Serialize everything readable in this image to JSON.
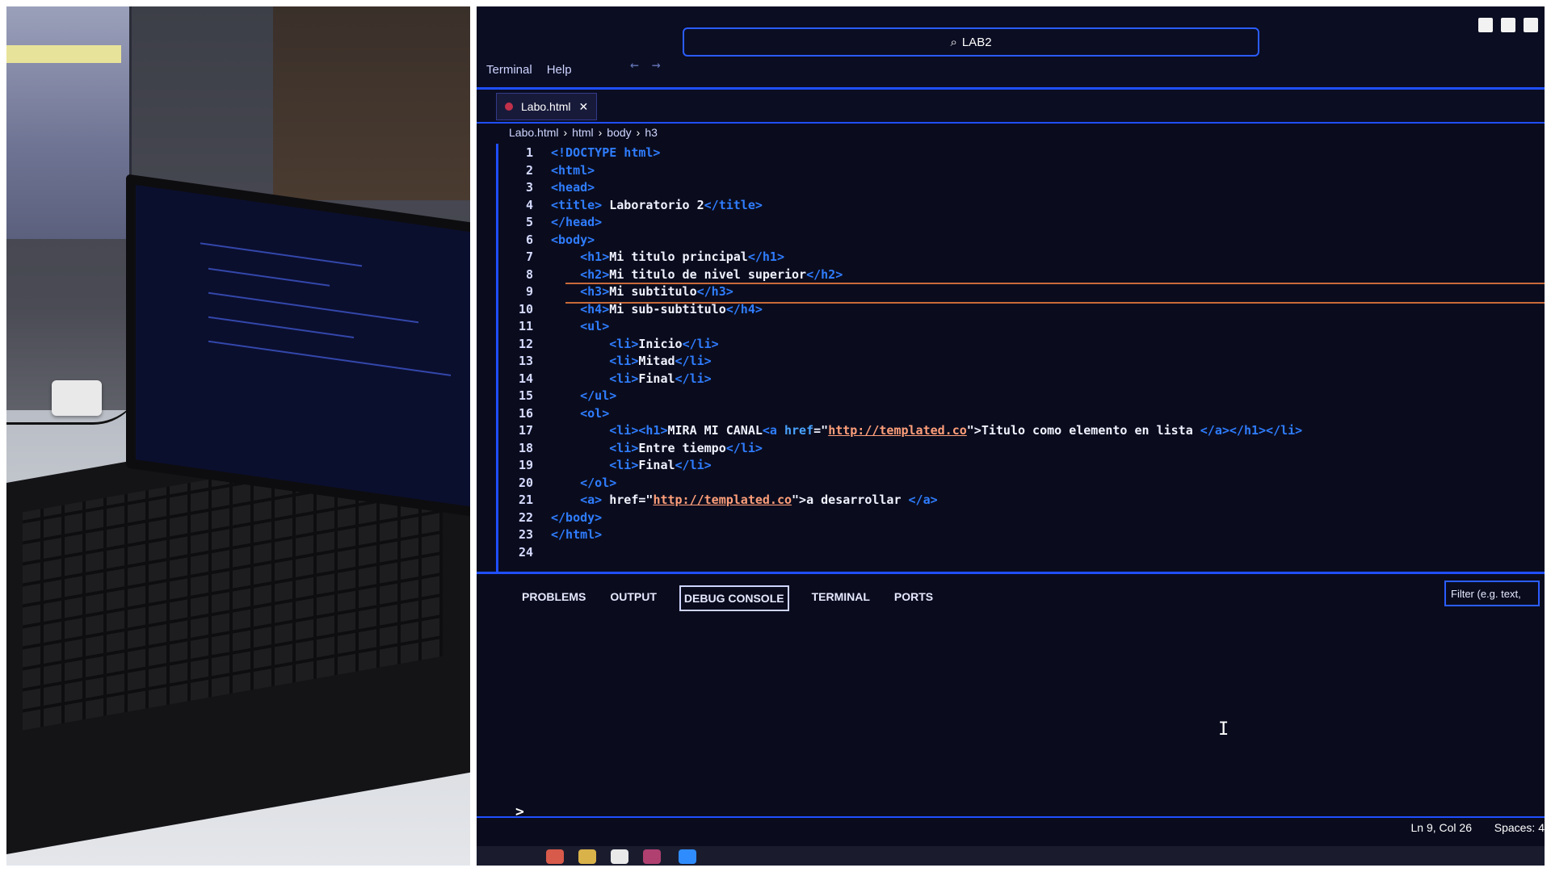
{
  "window": {
    "menu": [
      "Terminal",
      "Help"
    ],
    "search_label": "LAB2",
    "search_icon": "search-icon"
  },
  "tab": {
    "label": "Labo.html",
    "close": "✕"
  },
  "breadcrumb": [
    "Labo.html",
    "html",
    "body",
    "h3"
  ],
  "code": {
    "highlight_line": 9,
    "lines": [
      {
        "n": "1",
        "tokens": [
          {
            "c": "tag",
            "t": "<!DOCTYPE html>"
          }
        ]
      },
      {
        "n": "2",
        "tokens": [
          {
            "c": "tag",
            "t": "<html>"
          }
        ]
      },
      {
        "n": "3",
        "tokens": [
          {
            "c": "tag",
            "t": "<head>"
          }
        ]
      },
      {
        "n": "4",
        "tokens": [
          {
            "c": "tag",
            "t": "<title>"
          },
          {
            "c": "txt",
            "t": " Laboratorio 2"
          },
          {
            "c": "tag",
            "t": "</title>"
          }
        ]
      },
      {
        "n": "5",
        "tokens": [
          {
            "c": "tag",
            "t": "</head>"
          }
        ]
      },
      {
        "n": "6",
        "tokens": [
          {
            "c": "tag",
            "t": "<body>"
          }
        ]
      },
      {
        "n": "7",
        "tokens": [
          {
            "c": "txt",
            "t": "    "
          },
          {
            "c": "tag",
            "t": "<h1>"
          },
          {
            "c": "txt",
            "t": "Mi titulo principal"
          },
          {
            "c": "tag",
            "t": "</h1>"
          }
        ]
      },
      {
        "n": "8",
        "tokens": [
          {
            "c": "txt",
            "t": "    "
          },
          {
            "c": "tag",
            "t": "<h2>"
          },
          {
            "c": "txt",
            "t": "Mi titulo de nivel superior"
          },
          {
            "c": "tag",
            "t": "</h2>"
          }
        ]
      },
      {
        "n": "9",
        "tokens": [
          {
            "c": "txt",
            "t": "    "
          },
          {
            "c": "tag",
            "t": "<h3>"
          },
          {
            "c": "txt",
            "t": "Mi subtitulo"
          },
          {
            "c": "tag",
            "t": "</h3>"
          }
        ]
      },
      {
        "n": "10",
        "tokens": [
          {
            "c": "txt",
            "t": "    "
          },
          {
            "c": "tag",
            "t": "<h4>"
          },
          {
            "c": "txt",
            "t": "Mi sub-subtitulo"
          },
          {
            "c": "tag",
            "t": "</h4>"
          }
        ]
      },
      {
        "n": "11",
        "tokens": [
          {
            "c": "txt",
            "t": "    "
          },
          {
            "c": "tag",
            "t": "<ul>"
          }
        ]
      },
      {
        "n": "12",
        "tokens": [
          {
            "c": "txt",
            "t": "        "
          },
          {
            "c": "tag",
            "t": "<li>"
          },
          {
            "c": "txt",
            "t": "Inicio"
          },
          {
            "c": "tag",
            "t": "</li>"
          }
        ]
      },
      {
        "n": "13",
        "tokens": [
          {
            "c": "txt",
            "t": "        "
          },
          {
            "c": "tag",
            "t": "<li>"
          },
          {
            "c": "txt",
            "t": "Mitad"
          },
          {
            "c": "tag",
            "t": "</li>"
          }
        ]
      },
      {
        "n": "14",
        "tokens": [
          {
            "c": "txt",
            "t": "        "
          },
          {
            "c": "tag",
            "t": "<li>"
          },
          {
            "c": "txt",
            "t": "Final"
          },
          {
            "c": "tag",
            "t": "</li>"
          }
        ]
      },
      {
        "n": "15",
        "tokens": [
          {
            "c": "txt",
            "t": "    "
          },
          {
            "c": "tag",
            "t": "</ul>"
          }
        ]
      },
      {
        "n": "16",
        "tokens": [
          {
            "c": "txt",
            "t": "    "
          },
          {
            "c": "tag",
            "t": "<ol>"
          }
        ]
      },
      {
        "n": "17",
        "tokens": [
          {
            "c": "txt",
            "t": "        "
          },
          {
            "c": "tag",
            "t": "<li><h1>"
          },
          {
            "c": "txt",
            "t": "MIRA MI CANAL"
          },
          {
            "c": "tag",
            "t": "<a "
          },
          {
            "c": "attr",
            "t": "href"
          },
          {
            "c": "txt",
            "t": "=\""
          },
          {
            "c": "url",
            "t": "http://templated.co"
          },
          {
            "c": "txt",
            "t": "\">Titulo como elemento en lista "
          },
          {
            "c": "tag",
            "t": "</a></h1></li>"
          }
        ]
      },
      {
        "n": "18",
        "tokens": [
          {
            "c": "txt",
            "t": "        "
          },
          {
            "c": "tag",
            "t": "<li>"
          },
          {
            "c": "txt",
            "t": "Entre tiempo"
          },
          {
            "c": "tag",
            "t": "</li>"
          }
        ]
      },
      {
        "n": "19",
        "tokens": [
          {
            "c": "txt",
            "t": "        "
          },
          {
            "c": "tag",
            "t": "<li>"
          },
          {
            "c": "txt",
            "t": "Final"
          },
          {
            "c": "tag",
            "t": "</li>"
          }
        ]
      },
      {
        "n": "20",
        "tokens": [
          {
            "c": "txt",
            "t": "    "
          },
          {
            "c": "tag",
            "t": "</ol>"
          }
        ]
      },
      {
        "n": "21",
        "tokens": [
          {
            "c": "txt",
            "t": "    "
          },
          {
            "c": "tag",
            "t": "<a>"
          },
          {
            "c": "txt",
            "t": " href=\""
          },
          {
            "c": "url",
            "t": "http://templated.co"
          },
          {
            "c": "txt",
            "t": "\">a desarrollar "
          },
          {
            "c": "tag",
            "t": "</a>"
          }
        ]
      },
      {
        "n": "22",
        "tokens": [
          {
            "c": "tag",
            "t": "</body>"
          }
        ]
      },
      {
        "n": "23",
        "tokens": [
          {
            "c": "tag",
            "t": "</html>"
          }
        ]
      },
      {
        "n": "24",
        "tokens": []
      }
    ]
  },
  "panel": {
    "tabs": [
      "PROBLEMS",
      "OUTPUT",
      "DEBUG CONSOLE",
      "TERMINAL",
      "PORTS"
    ],
    "active_tab": "DEBUG CONSOLE",
    "filter_placeholder": "Filter (e.g. text,",
    "prompt": ">"
  },
  "status": {
    "position": "Ln 9, Col 26",
    "spaces": "Spaces: 4"
  },
  "colors": {
    "accent": "#1f4fff",
    "tag": "#2f7dff",
    "highlight": "#c86a3a",
    "background": "#0a0c1e"
  }
}
